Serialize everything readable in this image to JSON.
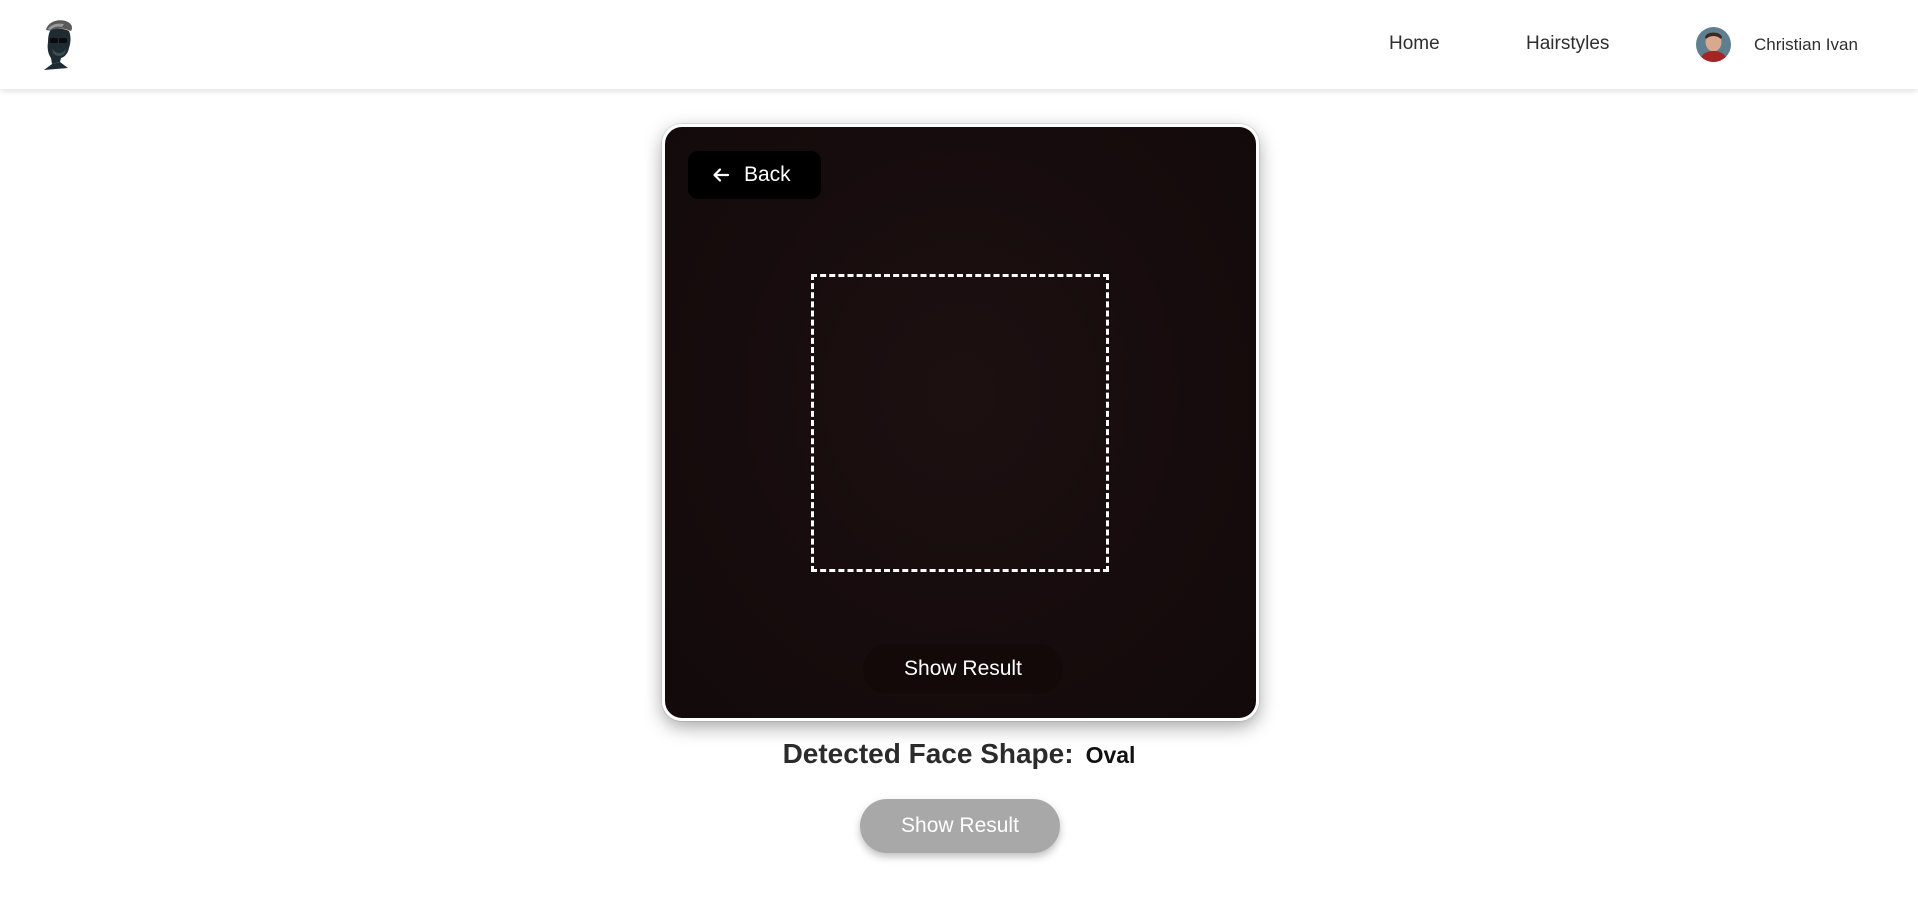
{
  "header": {
    "logo_icon": "barber-man-logo-icon",
    "nav": {
      "home_label": "Home",
      "hairstyles_label": "Hairstyles"
    },
    "user": {
      "name": "Christian Ivan",
      "avatar_icon": "user-avatar"
    }
  },
  "camera": {
    "back_label": "Back",
    "back_icon": "arrow-left-icon",
    "overlay_button_label": "Show Result"
  },
  "result": {
    "detected_label": "Detected Face Shape:",
    "detected_value": "Oval",
    "button_label": "Show Result"
  },
  "colors": {
    "camera_bg": "#170c0d",
    "back_button_bg": "#000000",
    "disabled_button_bg": "#a8a8a8"
  }
}
